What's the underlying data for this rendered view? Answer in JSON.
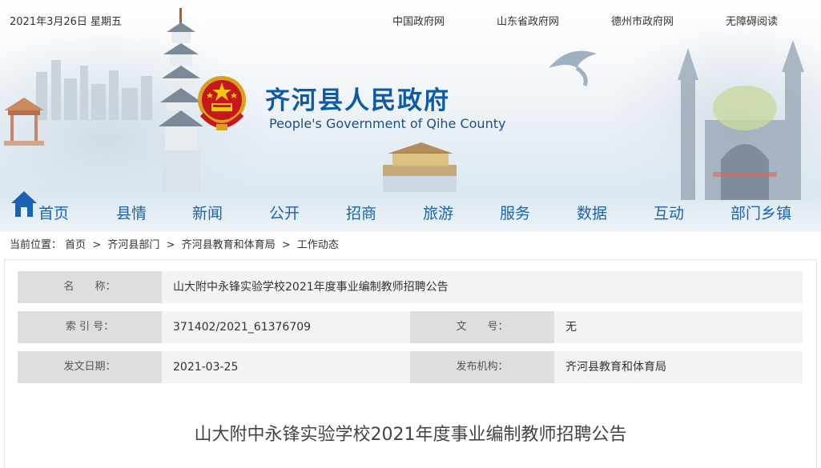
{
  "header": {
    "date": "2021年3月26日 星期五",
    "links": [
      "中国政府网",
      "山东省政府网",
      "德州市政府网",
      "无障碍阅读"
    ],
    "title_cn": "齐河县人民政府",
    "title_en": "People's Government of Qihe County"
  },
  "nav": {
    "items": [
      "首页",
      "县情",
      "新闻",
      "公开",
      "招商",
      "旅游",
      "服务",
      "数据",
      "互动",
      "部门乡镇"
    ]
  },
  "breadcrumb": {
    "prefix": "当前位置：",
    "items": [
      "首页",
      "齐河县部门",
      "齐河县教育和体育局",
      "工作动态"
    ],
    "separator": ">"
  },
  "info": {
    "name_label": "名　　称：",
    "name_value": "山大附中永锋实验学校2021年度事业编制教师招聘公告",
    "index_label": "索 引 号：",
    "index_value": "371402/2021_61376709",
    "docno_label": "文　　号：",
    "docno_value": "无",
    "date_label": "发文日期：",
    "date_value": "2021-03-25",
    "org_label": "发布机构：",
    "org_value": "齐河县教育和体育局"
  },
  "article": {
    "title": "山大附中永锋实验学校2021年度事业编制教师招聘公告"
  },
  "colors": {
    "nav_text": "#1a63b4",
    "title_blue": "#0d5aa7",
    "label_bg": "#dedede",
    "value_bg": "#f3f3f3"
  }
}
